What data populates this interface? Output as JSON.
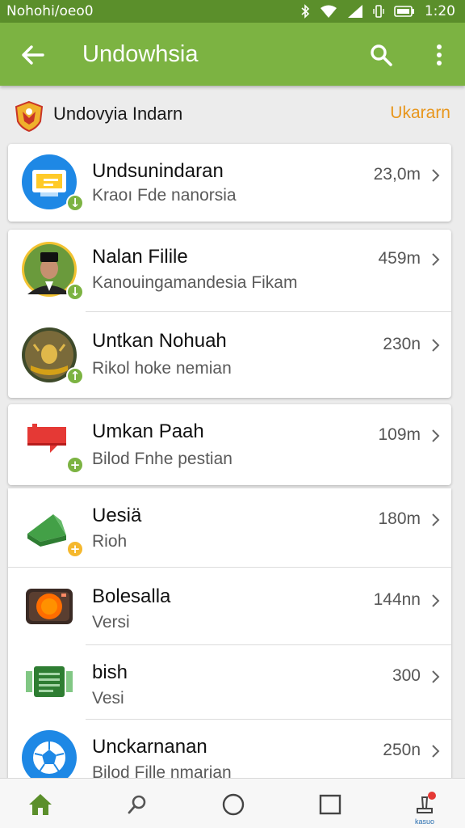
{
  "status_bar": {
    "left_text": "Nohohi/oeo0",
    "time": "1:20",
    "icons": [
      "bluetooth-icon",
      "wifi-icon",
      "signal-icon",
      "vibrate-icon",
      "battery-icon"
    ]
  },
  "app_bar": {
    "title": "Undowhsia",
    "back_icon": "arrow-back-icon",
    "search_icon": "search-icon",
    "more_icon": "more-vert-icon",
    "color": "#7cb342"
  },
  "section": {
    "title": "Undovyia Indarn",
    "link": "Ukararn",
    "link_color": "#e8961c"
  },
  "items": [
    {
      "name": "Undsunindaran",
      "sub": "Kraoı Fde nanorsia",
      "size": "23,0m",
      "badge": "down",
      "badge_color": "#7cb342"
    },
    {
      "name": "Nalan Filile",
      "sub": "Kanouingamandesia Fikam",
      "size": "459m",
      "badge": "down",
      "badge_color": "#7cb342"
    },
    {
      "name": "Untkan Nohuah",
      "sub": "Rikol hoke nemian",
      "size": "230n",
      "badge": "up",
      "badge_color": "#7cb342"
    },
    {
      "name": "Umkan Paah",
      "sub": "Bilod Fnhe pestian",
      "size": "109m",
      "badge": "plus",
      "badge_color": "#7cb342"
    },
    {
      "name": "Uesiä",
      "sub": "Rioh",
      "size": "180m",
      "badge": "plus",
      "badge_color": "#f5b82e"
    },
    {
      "name": "Bolesalla",
      "sub": "Versi",
      "size": "144nn",
      "badge": "",
      "badge_color": ""
    },
    {
      "name": "bish",
      "sub": "Vesi",
      "size": "300",
      "badge": "",
      "badge_color": ""
    },
    {
      "name": "Unckarnanan",
      "sub": "Bilod Fille nmarian",
      "size": "250n",
      "badge": "",
      "badge_color": ""
    }
  ],
  "bottom_nav": {
    "items": [
      "home-icon",
      "search-icon",
      "circle-icon",
      "square-icon",
      "notification-icon"
    ],
    "label": "kasuo",
    "active_color": "#5b8f2b"
  }
}
